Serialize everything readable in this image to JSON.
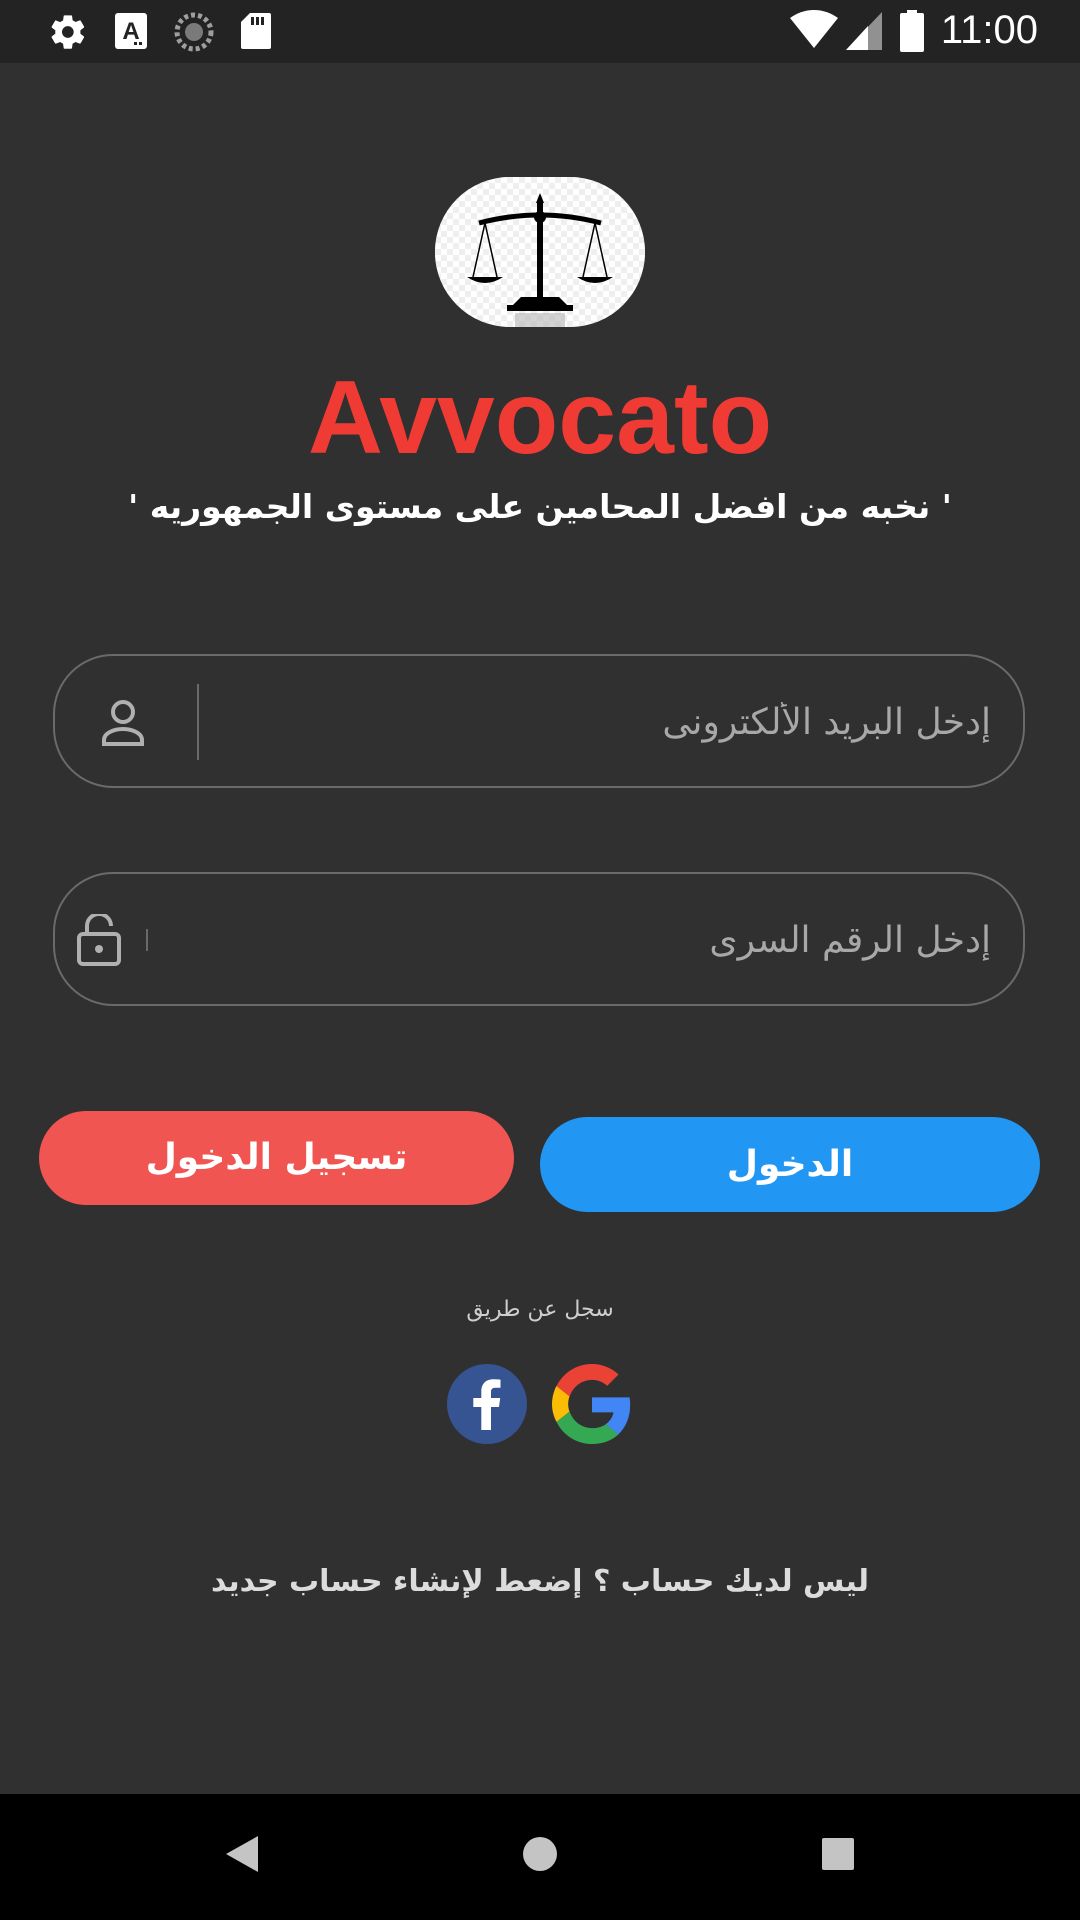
{
  "status_bar": {
    "time": "11:00",
    "left_icons": [
      "gear-icon",
      "text-a-icon",
      "sync-icon",
      "sd-card-icon"
    ],
    "right_icons": [
      "wifi-icon",
      "cellular-icon",
      "battery-icon"
    ]
  },
  "logo": {
    "icon": "scales-of-justice-icon"
  },
  "app": {
    "title": "Avvocato",
    "title_color": "#f03b35",
    "tagline": "' نخبه من افضل المحامين على مستوى الجمهوريه '"
  },
  "form": {
    "email_placeholder": "إدخل البريد الألكترونى",
    "password_placeholder": "إدخل الرقم السرى",
    "email_icon": "person-icon",
    "password_icon": "lock-open-icon"
  },
  "buttons": {
    "register_label": "تسجيل الدخول",
    "register_color": "#f05552",
    "login_label": "الدخول",
    "login_color": "#2196f3"
  },
  "social": {
    "label": "سجل عن طريق",
    "providers": [
      "facebook-icon",
      "google-icon"
    ]
  },
  "signup": {
    "text": "ليس لديك حساب ؟ إضعط لإنشاء حساب جديد"
  },
  "nav_bar": {
    "buttons": [
      "back-icon",
      "home-icon",
      "recents-icon"
    ]
  }
}
